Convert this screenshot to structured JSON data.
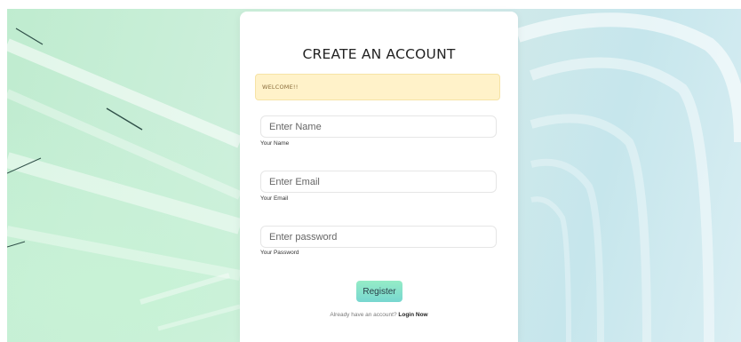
{
  "form": {
    "title": "CREATE AN ACCOUNT",
    "alert_text": "WELCOME!!",
    "name": {
      "placeholder": "Enter Name",
      "label": "Your Name"
    },
    "email": {
      "placeholder": "Enter Email",
      "label": "Your Email"
    },
    "password": {
      "placeholder": "Enter password",
      "label": "Your Password"
    },
    "register_label": "Register",
    "login_prompt": "Already have an account?",
    "login_link": "Login Now"
  },
  "colors": {
    "alert_bg": "#fff2c9",
    "button_gradient_start": "#95ecc6",
    "button_gradient_end": "#78d7d0"
  }
}
